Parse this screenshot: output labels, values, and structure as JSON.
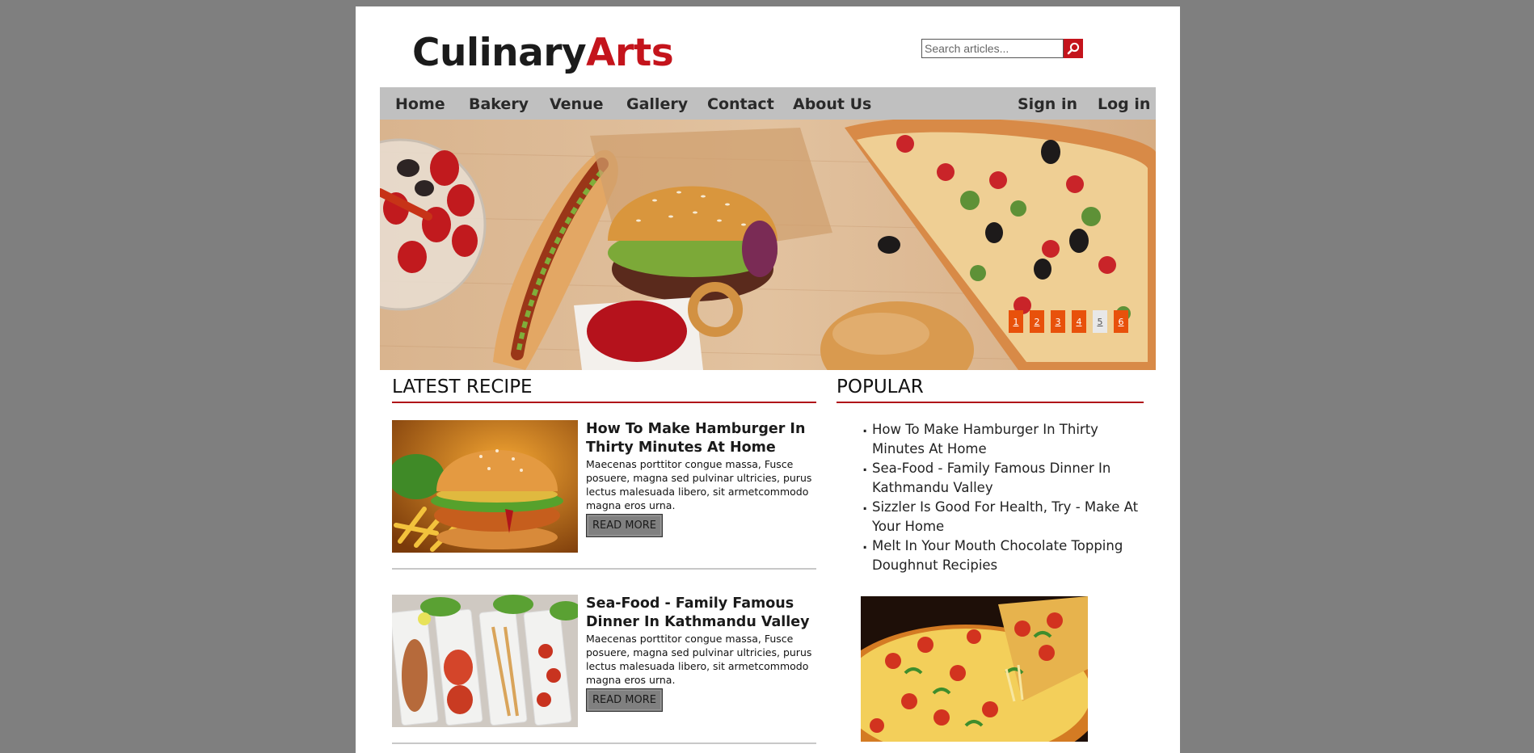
{
  "brand": {
    "part1": "Culinary",
    "part2": "Arts",
    "accent": "#c4141c"
  },
  "search": {
    "placeholder": "Search articles...",
    "icon": "search-icon"
  },
  "nav": {
    "items": [
      "Home",
      "Bakery",
      "Venue",
      "Gallery",
      "Contact",
      "About Us"
    ],
    "account": [
      "Sign in",
      "Log in"
    ]
  },
  "slider": {
    "pages": [
      "1",
      "2",
      "3",
      "4",
      "5",
      "6"
    ],
    "active_page": "5"
  },
  "latest": {
    "heading": "LATEST RECIPE",
    "posts": [
      {
        "title": "How To Make Hamburger In Thirty Minutes At Home",
        "excerpt": "Maecenas porttitor congue massa, Fusce posuere, magna sed pulvinar ultricies, purus lectus malesuada libero, sit armetcommodo magna eros urna.",
        "button": "READ MORE"
      },
      {
        "title": "Sea-Food - Family Famous Dinner In Kathmandu Valley",
        "excerpt": "Maecenas porttitor congue massa, Fusce posuere, magna sed pulvinar ultricies, purus lectus malesuada libero, sit armetcommodo magna eros urna.",
        "button": "READ MORE"
      }
    ]
  },
  "popular": {
    "heading": "POPULAR",
    "items": [
      "How To Make Hamburger In Thirty Minutes At Home",
      "Sea-Food - Family Famous Dinner In Kathmandu Valley",
      "Sizzler Is Good For Health, Try - Make At Your Home",
      "Melt In Your Mouth Chocolate Topping Doughnut Recipies"
    ]
  }
}
